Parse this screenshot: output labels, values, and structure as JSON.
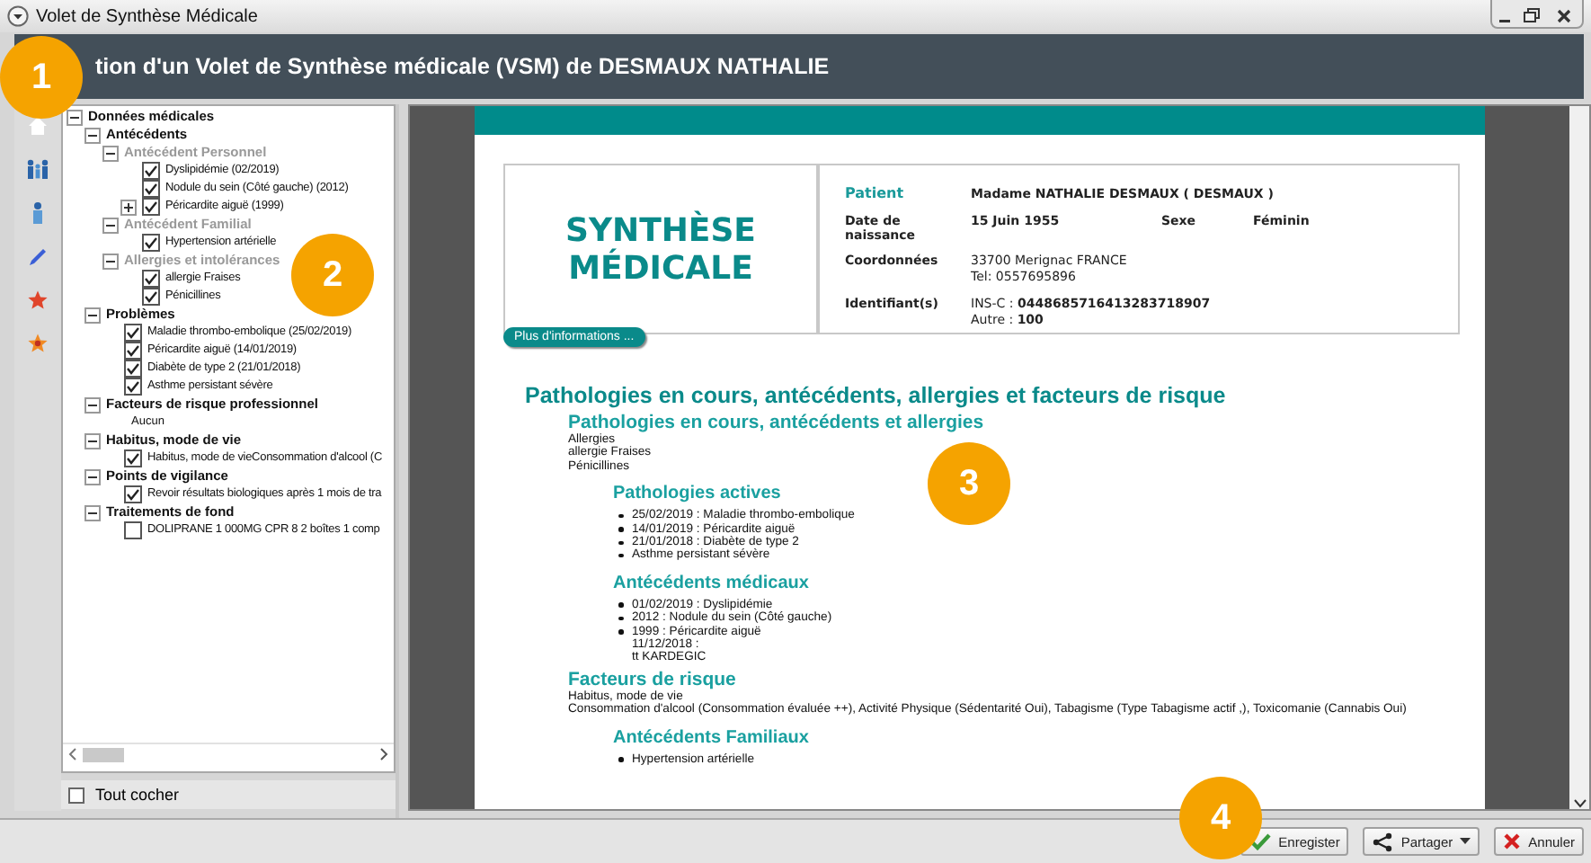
{
  "window": {
    "title": "Volet de Synthèse Médicale"
  },
  "header": {
    "title": "tion d'un Volet de Synthèse  médicale (VSM) de DESMAUX NATHALIE"
  },
  "tree": [
    {
      "label": "Données médicales",
      "kind": "group",
      "expanded": true,
      "children": [
        {
          "label": "Antécédents",
          "kind": "group",
          "expanded": true,
          "children": [
            {
              "label": "Antécédent Personnel",
              "kind": "subgroup",
              "expanded": true,
              "children": [
                {
                  "label": "Dyslipidémie (02/2019)",
                  "kind": "check",
                  "checked": true
                },
                {
                  "label": "Nodule du sein (Côté gauche) (2012)",
                  "kind": "check",
                  "checked": true
                },
                {
                  "label": "Péricardite aiguë (1999)",
                  "kind": "check",
                  "checked": true,
                  "expanded": false
                }
              ]
            },
            {
              "label": "Antécédent Familial",
              "kind": "subgroup",
              "expanded": true,
              "children": [
                {
                  "label": "Hypertension artérielle",
                  "kind": "check",
                  "checked": true
                }
              ]
            },
            {
              "label": "Allergies et intolérances",
              "kind": "subgroup",
              "expanded": true,
              "children": [
                {
                  "label": "allergie Fraises",
                  "kind": "check",
                  "checked": true
                },
                {
                  "label": "Pénicillines",
                  "kind": "check",
                  "checked": true
                }
              ]
            }
          ]
        },
        {
          "label": "Problèmes",
          "kind": "group",
          "expanded": true,
          "children": [
            {
              "label": "Maladie thrombo-embolique (25/02/2019)",
              "kind": "check",
              "checked": true
            },
            {
              "label": "Péricardite aiguë (14/01/2019)",
              "kind": "check",
              "checked": true
            },
            {
              "label": "Diabète de type 2 (21/01/2018)",
              "kind": "check",
              "checked": true
            },
            {
              "label": "Asthme persistant sévère",
              "kind": "check",
              "checked": true
            }
          ]
        },
        {
          "label": "Facteurs de risque professionnel",
          "kind": "group",
          "expanded": true,
          "children": [
            {
              "label": "Aucun",
              "kind": "text"
            }
          ]
        },
        {
          "label": "Habitus, mode de vie",
          "kind": "group",
          "expanded": true,
          "children": [
            {
              "label": "Habitus, mode de vieConsommation d'alcool (C",
              "kind": "check",
              "checked": true
            }
          ]
        },
        {
          "label": "Points de vigilance",
          "kind": "group",
          "expanded": true,
          "children": [
            {
              "label": "Revoir résultats biologiques après 1 mois de tra",
              "kind": "check",
              "checked": true
            }
          ]
        },
        {
          "label": "Traitements de fond",
          "kind": "group",
          "expanded": true,
          "children": [
            {
              "label": "DOLIPRANE 1 000MG CPR 8  2 boîtes 1 comp",
              "kind": "check",
              "checked": false
            }
          ]
        }
      ]
    }
  ],
  "select_all": {
    "label": "Tout cocher",
    "checked": false
  },
  "document": {
    "title": "SYNTHÈSE MÉDICALE",
    "info": [
      {
        "kind": "patient",
        "label": "Patient",
        "lines": [
          "Madame NATHALIE DESMAUX ( DESMAUX )"
        ]
      },
      {
        "kind": "bold",
        "label": "Date de naissance",
        "lines": [
          "15 Juin 1955"
        ],
        "extra_label": "Sexe",
        "extra_value": "Féminin"
      },
      {
        "kind": "plain",
        "label": "Coordonnées",
        "lines": [
          "33700 Merignac FRANCE",
          "Tel: 0557695896"
        ]
      },
      {
        "kind": "plain",
        "label": "Identifiant(s)",
        "lines": [
          "INS-C : **0448685716413283718907**",
          "Autre : **100**"
        ]
      }
    ],
    "more_button": "Plus d'informations ...",
    "heading": "Pathologies en cours, antécédents, allergies et facteurs de risque",
    "content": [
      {
        "kind": "h2",
        "text": "Pathologies en cours, antécédents et allergies"
      },
      {
        "kind": "lines",
        "lines": [
          "Allergies",
          "allergie Fraises",
          "Pénicillines"
        ]
      },
      {
        "kind": "h3",
        "text": "Pathologies actives"
      },
      {
        "kind": "bullets",
        "items": [
          {
            "lines": [
              "25/02/2019 : Maladie thrombo-embolique"
            ]
          },
          {
            "lines": [
              "14/01/2019 : Péricardite aiguë"
            ]
          },
          {
            "lines": [
              "21/01/2018 : Diabète de type 2"
            ]
          },
          {
            "lines": [
              "Asthme persistant sévère"
            ]
          }
        ]
      },
      {
        "kind": "h3",
        "text": "Antécédents médicaux"
      },
      {
        "kind": "bullets",
        "items": [
          {
            "lines": [
              "01/02/2019 : Dyslipidémie"
            ]
          },
          {
            "lines": [
              "2012 : Nodule du sein (Côté gauche)"
            ]
          },
          {
            "lines": [
              "1999 : Péricardite aiguë",
              "11/12/2018 :",
              "tt KARDEGIC"
            ]
          }
        ]
      },
      {
        "kind": "h2",
        "text": "Facteurs de risque"
      },
      {
        "kind": "lines",
        "lines": [
          "Habitus, mode de vie",
          "Consommation d'alcool (Consommation évaluée ++), Activité Physique (Sédentarité Oui), Tabagisme (Type Tabagisme actif ,), Toxicomanie (Cannabis Oui)"
        ]
      },
      {
        "kind": "h3",
        "text": "Antécédents Familiaux"
      },
      {
        "kind": "bullets",
        "items": [
          {
            "lines": [
              "Hypertension artérielle"
            ]
          }
        ]
      }
    ]
  },
  "buttons": [
    {
      "kind": "save",
      "label": "Enregister"
    },
    {
      "kind": "share",
      "label": "Partager"
    },
    {
      "kind": "cancel",
      "label": "Annuler"
    }
  ],
  "callouts": [
    {
      "label": "1"
    },
    {
      "label": "2"
    },
    {
      "label": "3"
    },
    {
      "label": "4"
    }
  ]
}
